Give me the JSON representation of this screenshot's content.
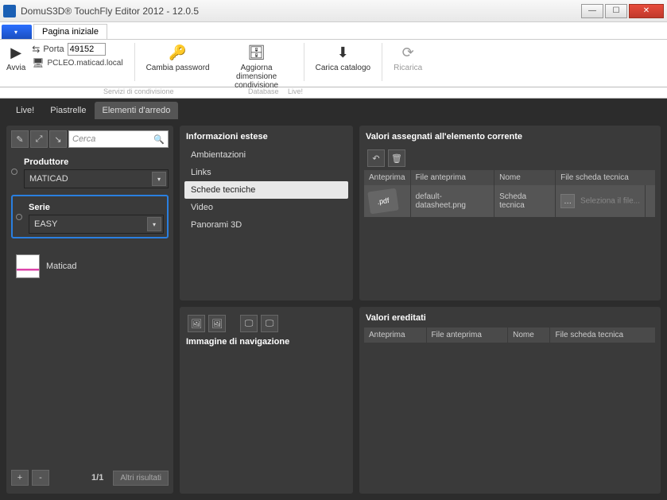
{
  "window": {
    "title": "DomuS3D® TouchFly Editor 2012 - 12.0.5"
  },
  "ribbon": {
    "file_tab": "",
    "tab_home": "Pagina iniziale",
    "start_label": "Avvia",
    "port_label": "Porta",
    "port_value": "49152",
    "server": "PCLEO.maticad.local",
    "change_password": "Cambia password",
    "update_share": "Aggiorna dimensione condivisione",
    "group_share": "Servizi di condivisione",
    "load_catalog": "Carica catalogo",
    "group_db": "Database",
    "reload": "Ricarica",
    "group_live": "Live!"
  },
  "tabs": {
    "live": "Live!",
    "tiles": "Piastrelle",
    "furniture": "Elementi d'arredo"
  },
  "left": {
    "search_placeholder": "Cerca",
    "producer_label": "Produttore",
    "producer_value": "MATICAD",
    "series_label": "Serie",
    "series_value": "EASY",
    "result_name": "Maticad",
    "page": "1/1",
    "more_results": "Altri risultati"
  },
  "info": {
    "title": "Informazioni estese",
    "items": [
      "Ambientazioni",
      "Links",
      "Schede tecniche",
      "Video",
      "Panorami 3D"
    ]
  },
  "nav_image": {
    "title": "Immagine di navigazione"
  },
  "assigned": {
    "title": "Valori assegnati all'elemento corrente",
    "cols": [
      "Anteprima",
      "File anteprima",
      "Nome",
      "File scheda tecnica"
    ],
    "row": {
      "preview_label": ".pdf",
      "file_preview": "default-datasheet.png",
      "name": "Scheda tecnica",
      "file_placeholder": "Seleziona il file..."
    }
  },
  "inherited": {
    "title": "Valori ereditati",
    "cols": [
      "Anteprima",
      "File anteprima",
      "Nome",
      "File scheda tecnica"
    ]
  }
}
